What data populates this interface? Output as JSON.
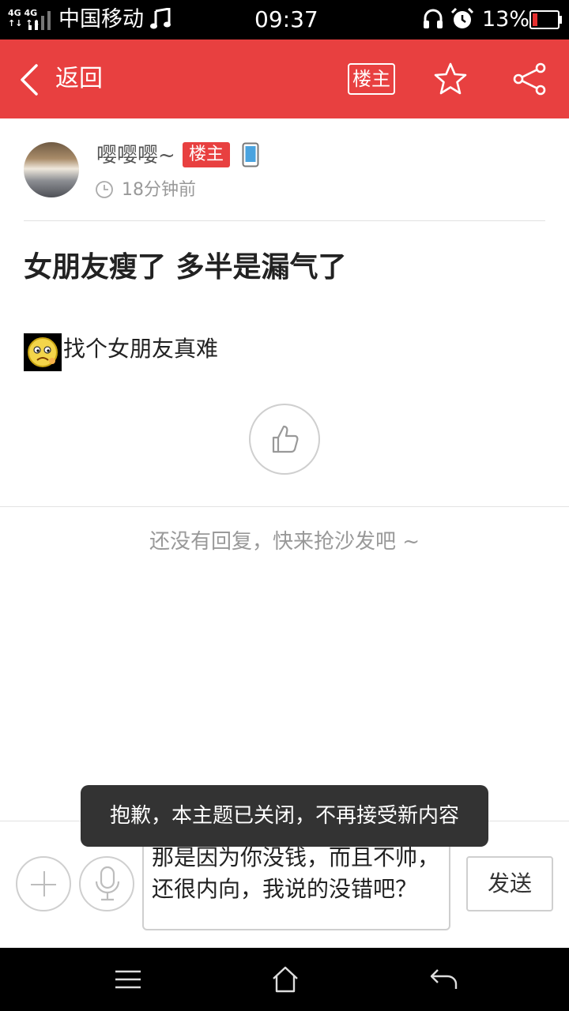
{
  "status_bar": {
    "network": "4G 4G",
    "carrier": "中国移动",
    "time": "09:37",
    "battery_percent": "13%",
    "icons": [
      "signal-icon",
      "music-icon",
      "headset-icon",
      "alarm-icon",
      "battery-icon"
    ]
  },
  "header": {
    "back_label": "返回",
    "owner_only_label": "楼主",
    "icons": [
      "back-icon",
      "star-icon",
      "share-icon"
    ],
    "accent_color": "#e84040"
  },
  "post": {
    "author": "嘤嘤嘤~",
    "owner_badge": "楼主",
    "time": "18分钟前",
    "title": "女朋友瘦了 多半是漏气了",
    "body": "找个女朋友真难"
  },
  "replies": {
    "empty_hint": "还没有回复，快来抢沙发吧 ~"
  },
  "reply_bar": {
    "input_value": "那是因为你没钱，而且不帅，还很内向，我说的没错吧？",
    "send_label": "发送"
  },
  "toast": {
    "message": "抱歉，本主题已关闭，不再接受新内容"
  },
  "nav_bar": {
    "icons": [
      "menu-icon",
      "home-icon",
      "back-nav-icon"
    ]
  }
}
